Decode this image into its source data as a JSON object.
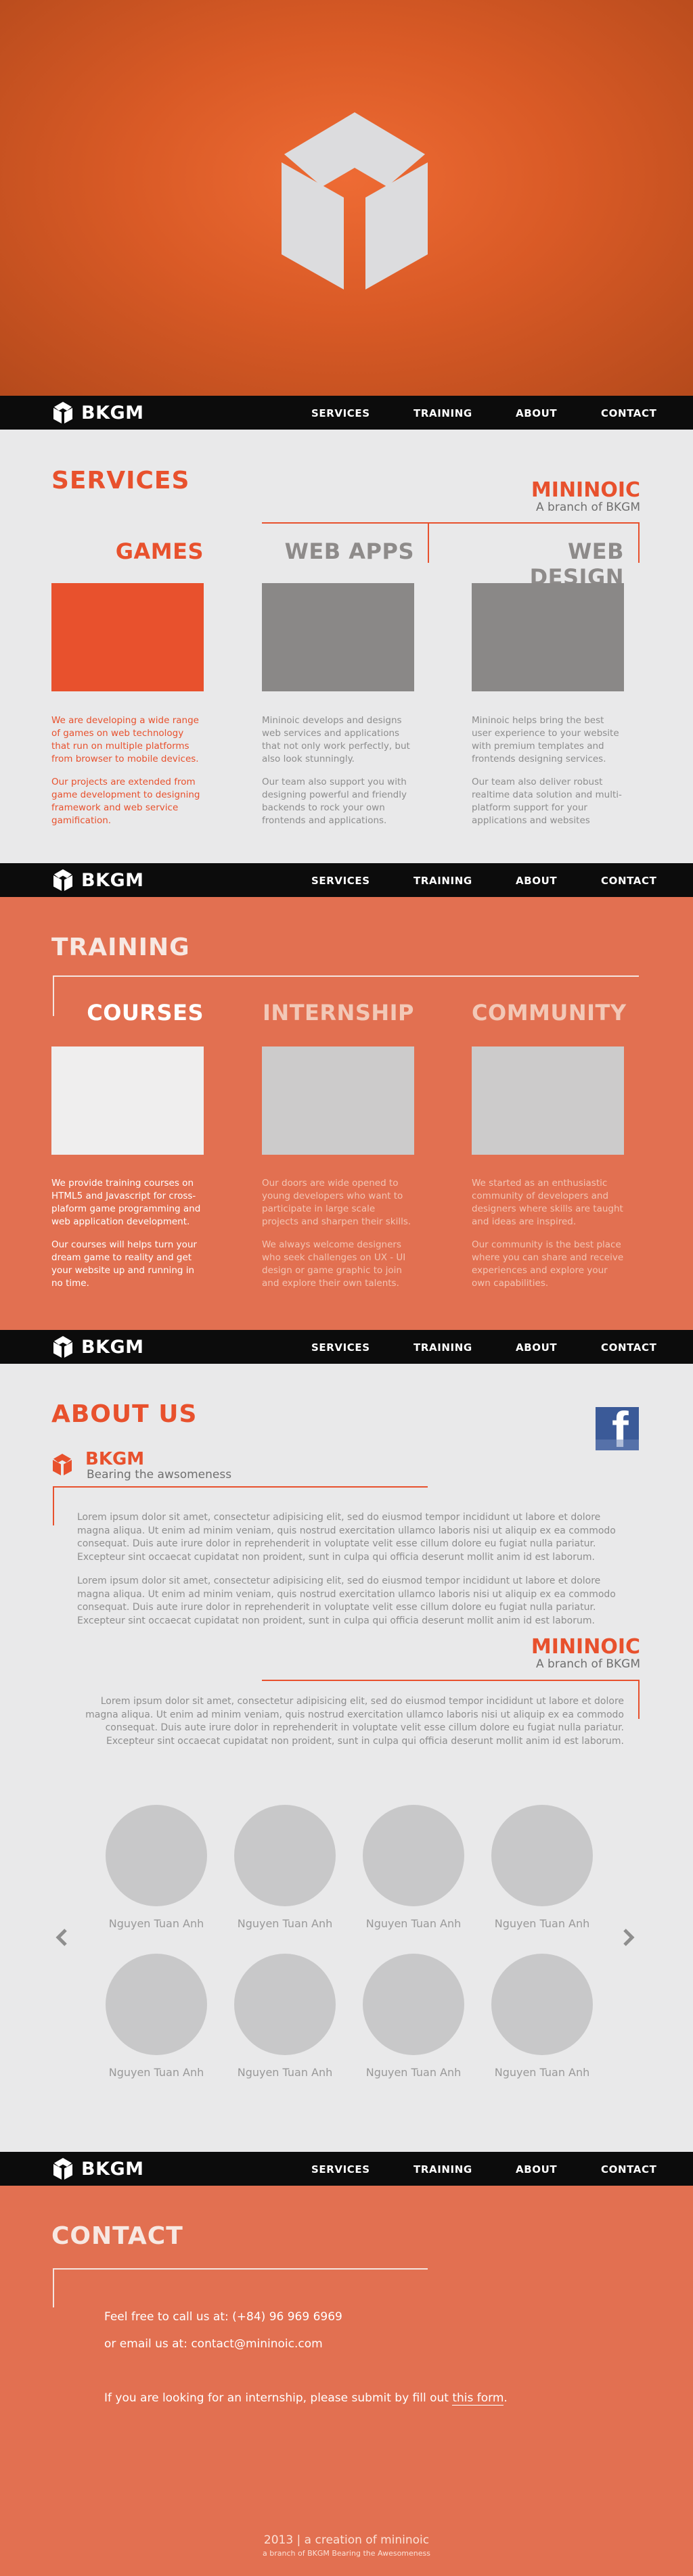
{
  "brand": {
    "name": "BKGM"
  },
  "nav": {
    "items": [
      "SERVICES",
      "TRAINING",
      "ABOUT",
      "CONTACT"
    ]
  },
  "services": {
    "title": "SERVICES",
    "org": {
      "name": "MININOIC",
      "tagline": "A branch of BKGM"
    },
    "columns": [
      {
        "title": "GAMES",
        "p1": "We are developing a wide range of games on web technology that run on multiple platforms from browser to mobile devices.",
        "p2": "Our projects are extended from game development to designing framework and web service gamification.",
        "color": "#e8512d"
      },
      {
        "title": "WEB APPS",
        "p1": "Mininoic develops and designs web services and applications that not only work perfectly, but also look stunningly.",
        "p2": "Our team also support you with designing powerful and friendly backends to rock your own frontends and applications.",
        "color": "#8a8887"
      },
      {
        "title": "WEB DESIGN",
        "p1": "Mininoic helps bring the best user experience to your website with premium templates and frontends designing services.",
        "p2": "Our team also deliver robust realtime data solution and multi-platform support for your applications and websites",
        "color": "#8a8887"
      }
    ]
  },
  "training": {
    "title": "TRAINING",
    "columns": [
      {
        "title": "COURSES",
        "p1": "We provide training courses on HTML5 and Javascript for cross-plaform game programming and web application development.",
        "p2": "Our courses will helps turn your dream game to reality and get your website up and running in no time."
      },
      {
        "title": "INTERNSHIP",
        "p1": "Our doors are wide opened to young developers who want to participate in large scale projects and sharpen their skills.",
        "p2": "We always welcome designers who seek challenges on UX - UI design or game graphic to join and explore their own talents."
      },
      {
        "title": "COMMUNITY",
        "p1": "We started as an enthusiastic community of developers and designers where skills are taught and ideas are inspired.",
        "p2": "Our community is the best place where you can share and receive experiences and explore your own capabilities."
      }
    ]
  },
  "about": {
    "title": "ABOUT US",
    "bkgm_name": "BKGM",
    "bkgm_tagline": "Bearing the awsomeness",
    "lorem1": "Lorem ipsum dolor sit amet, consectetur adipisicing elit, sed do eiusmod tempor incididunt ut labore et dolore magna aliqua. Ut enim ad minim veniam, quis nostrud exercitation ullamco laboris nisi ut aliquip ex ea commodo consequat. Duis aute irure dolor in reprehenderit in voluptate velit esse cillum dolore eu fugiat nulla pariatur. Excepteur sint occaecat cupidatat non proident, sunt in culpa qui officia deserunt mollit anim id est laborum.",
    "lorem2": "Lorem ipsum dolor sit amet, consectetur adipisicing elit, sed do eiusmod tempor incididunt ut labore et dolore magna aliqua. Ut enim ad minim veniam, quis nostrud exercitation ullamco laboris nisi ut aliquip ex ea commodo consequat. Duis aute irure dolor in reprehenderit in voluptate velit esse cillum dolore eu fugiat nulla pariatur. Excepteur sint occaecat cupidatat non proident, sunt in culpa qui officia deserunt mollit anim id est laborum.",
    "mininoic_name": "MININOIC",
    "mininoic_tagline": "A branch of BKGM",
    "lorem3": "Lorem ipsum dolor sit amet, consectetur adipisicing elit, sed do eiusmod tempor incididunt ut labore et dolore magna aliqua. Ut enim ad minim veniam, quis nostrud exercitation ullamco laboris nisi ut aliquip ex ea commodo consequat. Duis aute irure dolor in reprehenderit in voluptate velit esse cillum dolore eu fugiat nulla pariatur. Excepteur sint occaecat cupidatat non proident, sunt in culpa qui officia deserunt mollit anim id est laborum.",
    "members": [
      "Nguyen Tuan Anh",
      "Nguyen Tuan Anh",
      "Nguyen Tuan Anh",
      "Nguyen Tuan Anh",
      "Nguyen Tuan Anh",
      "Nguyen Tuan Anh",
      "Nguyen Tuan Anh",
      "Nguyen Tuan Anh"
    ],
    "facebook_glyph": "f"
  },
  "contact": {
    "title": "CONTACT",
    "phone_line": "Feel free to call us at: (+84) 96 969 6969",
    "email_line": "or email us at: contact@mininoic.com",
    "internship_prefix": "If you are looking for an internship, please submit by fill out ",
    "internship_link": "this form",
    "internship_suffix": ".",
    "footer_line1": "2013 | a creation of mininoic",
    "footer_line2": "a branch of BKGM Bearing the Awesomeness"
  },
  "colors": {
    "accent": "#e8512d",
    "dark_accent": "#d0462a",
    "nav": "#0c0c0c",
    "training_bg": "#e27051",
    "gray_box": "#8a8887"
  }
}
